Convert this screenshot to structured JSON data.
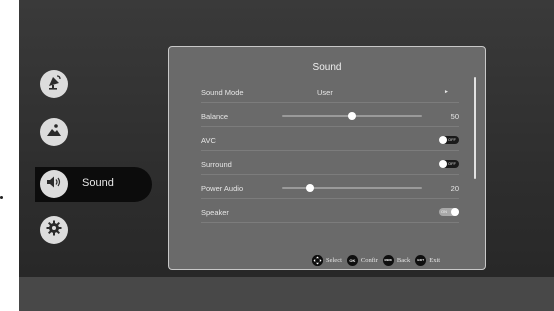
{
  "sidebar": {
    "items": [
      {
        "icon": "satellite-icon"
      },
      {
        "icon": "picture-icon"
      },
      {
        "icon": "speaker-icon",
        "label": "Sound",
        "selected": true
      },
      {
        "icon": "settings-gear-icon"
      }
    ]
  },
  "panel": {
    "title": "Sound",
    "rows": {
      "sound_mode": {
        "label": "Sound Mode",
        "value": "User",
        "arrow": "►"
      },
      "balance": {
        "label": "Balance",
        "value": "50",
        "level": 0.5
      },
      "avc": {
        "label": "AVC",
        "state": "OFF"
      },
      "surround": {
        "label": "Surround",
        "state": "OFF"
      },
      "power_audio": {
        "label": "Power Audio",
        "value": "20",
        "level": 0.2
      },
      "speaker": {
        "label": "Speaker",
        "state": "ON"
      }
    },
    "footer": {
      "select": {
        "icon": "dpad-icon",
        "label": "Select"
      },
      "confirm": {
        "icon": "ok-button-icon",
        "badge": "OK",
        "label": "Confir"
      },
      "back": {
        "icon": "menu-button-icon",
        "badge": "MENU",
        "label": "Back"
      },
      "exit": {
        "icon": "exit-button-icon",
        "badge": "EXIT",
        "label": "Exit"
      }
    }
  },
  "colors": {
    "screen_bg": "#2e2e2e",
    "panel_bg": "#6a6a6a",
    "panel_border": "#c8c8c8",
    "selected_item_bg": "#0c0c0c",
    "toggle_off": "#1a1a1a",
    "toggle_on": "#a8a8a8"
  }
}
